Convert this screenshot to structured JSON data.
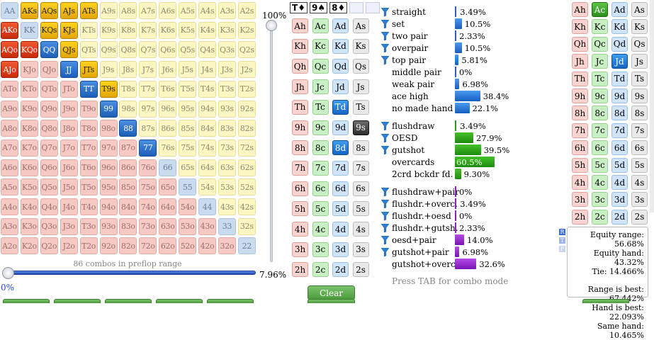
{
  "matrix": {
    "ranks": [
      "A",
      "K",
      "Q",
      "J",
      "T",
      "9",
      "8",
      "7",
      "6",
      "5",
      "4",
      "3",
      "2"
    ],
    "selected": [
      "AKs",
      "AQs",
      "AJs",
      "ATs",
      "AKo",
      "KQs",
      "KJs",
      "AQo",
      "KQo",
      "QQ",
      "QJs",
      "AJo",
      "JJ",
      "JTs",
      "TT",
      "T9s",
      "99",
      "88",
      "77"
    ],
    "combos_label": "86 combos in preflop range"
  },
  "sliders": {
    "vertical_pct": "100%",
    "vertical_level": 1.0,
    "range_pct": "7.96%",
    "range_zero": "0%",
    "range_level": 0.0
  },
  "board": {
    "cards": [
      {
        "rank": "T",
        "suit": "♦"
      },
      {
        "rank": "9",
        "suit": "♠"
      },
      {
        "rank": "8",
        "suit": "♦"
      }
    ]
  },
  "middle_grid": {
    "ranks": [
      "A",
      "K",
      "Q",
      "J",
      "T",
      "9",
      "8",
      "7",
      "6",
      "5",
      "4",
      "3",
      "2"
    ],
    "suits": [
      "h",
      "c",
      "d",
      "s"
    ],
    "selected": {
      "Td": "d",
      "9s": "s",
      "8d": "d"
    }
  },
  "right_grid": {
    "ranks": [
      "A",
      "K",
      "Q",
      "J",
      "T",
      "9",
      "8",
      "7",
      "6",
      "5",
      "4",
      "3",
      "2"
    ],
    "suits": [
      "h",
      "c",
      "d",
      "s"
    ],
    "selected": {
      "Ac": "c",
      "Jd": "d"
    }
  },
  "clear_label": "Clear",
  "stats": [
    {
      "label": "straight",
      "pct": 3.49,
      "text": "3.49%",
      "color": "blue",
      "filter": true
    },
    {
      "label": "set",
      "pct": 10.5,
      "text": "10.5%",
      "color": "blue",
      "filter": true
    },
    {
      "label": "two pair",
      "pct": 2.33,
      "text": "2.33%",
      "color": "blue",
      "filter": true
    },
    {
      "label": "overpair",
      "pct": 10.5,
      "text": "10.5%",
      "color": "blue",
      "filter": true
    },
    {
      "label": "top pair",
      "pct": 5.81,
      "text": "5.81%",
      "color": "blue",
      "filter": true
    },
    {
      "label": "middle pair",
      "pct": 0,
      "text": "0%",
      "color": "blue",
      "filter": false
    },
    {
      "label": "weak pair",
      "pct": 6.98,
      "text": "6.98%",
      "color": "blue",
      "filter": false
    },
    {
      "label": "ace high",
      "pct": 38.4,
      "text": "38.4%",
      "color": "blue",
      "filter": false
    },
    {
      "label": "no made hand",
      "pct": 22.1,
      "text": "22.1%",
      "color": "blue",
      "filter": false
    },
    {
      "label": "flushdraw",
      "pct": 3.49,
      "text": "3.49%",
      "color": "green",
      "filter": true
    },
    {
      "label": "OESD",
      "pct": 27.9,
      "text": "27.9%",
      "color": "green",
      "filter": true
    },
    {
      "label": "gutshot",
      "pct": 39.5,
      "text": "39.5%",
      "color": "green",
      "filter": true
    },
    {
      "label": "overcards",
      "pct": 60.5,
      "text": "60.5%",
      "color": "green",
      "filter": false
    },
    {
      "label": "2crd bckdr fd.",
      "pct": 9.3,
      "text": "9.30%",
      "color": "green",
      "filter": false
    },
    {
      "label": "flushdraw+pair",
      "pct": 0,
      "text": "0%",
      "color": "purple",
      "filter": true
    },
    {
      "label": "flushdr.+overc.",
      "pct": 3.49,
      "text": "3.49%",
      "color": "purple",
      "filter": true
    },
    {
      "label": "flushdr.+oesd",
      "pct": 0,
      "text": "0%",
      "color": "purple",
      "filter": true
    },
    {
      "label": "flushdr.+gutsh.",
      "pct": 2.33,
      "text": "2.33%",
      "color": "purple",
      "filter": true
    },
    {
      "label": "oesd+pair",
      "pct": 14.0,
      "text": "14.0%",
      "color": "purple",
      "filter": true
    },
    {
      "label": "gutshot+pair",
      "pct": 6.98,
      "text": "6.98%",
      "color": "purple",
      "filter": true
    },
    {
      "label": "gutshot+overc.",
      "pct": 32.6,
      "text": "32.6%",
      "color": "purple",
      "filter": false
    }
  ],
  "tab_hint": "Press TAB for combo mode",
  "equity": {
    "range": "Equity range: 56.68%",
    "hand": "Equity hand: 43.32%",
    "tie": "Tie: 14.466%",
    "range_best": "Range is best: 67.442%",
    "hand_best": "Hand is best: 22.093%",
    "same": "Same hand: 10.465%"
  },
  "badges": [
    "R",
    "T",
    "F"
  ],
  "colors": {
    "accent_blue": "#1d5fb8",
    "accent_gold": "#e3a60a",
    "accent_red": "#c82a0c",
    "green": "#2b8e1c",
    "purple": "#7a14b8"
  }
}
